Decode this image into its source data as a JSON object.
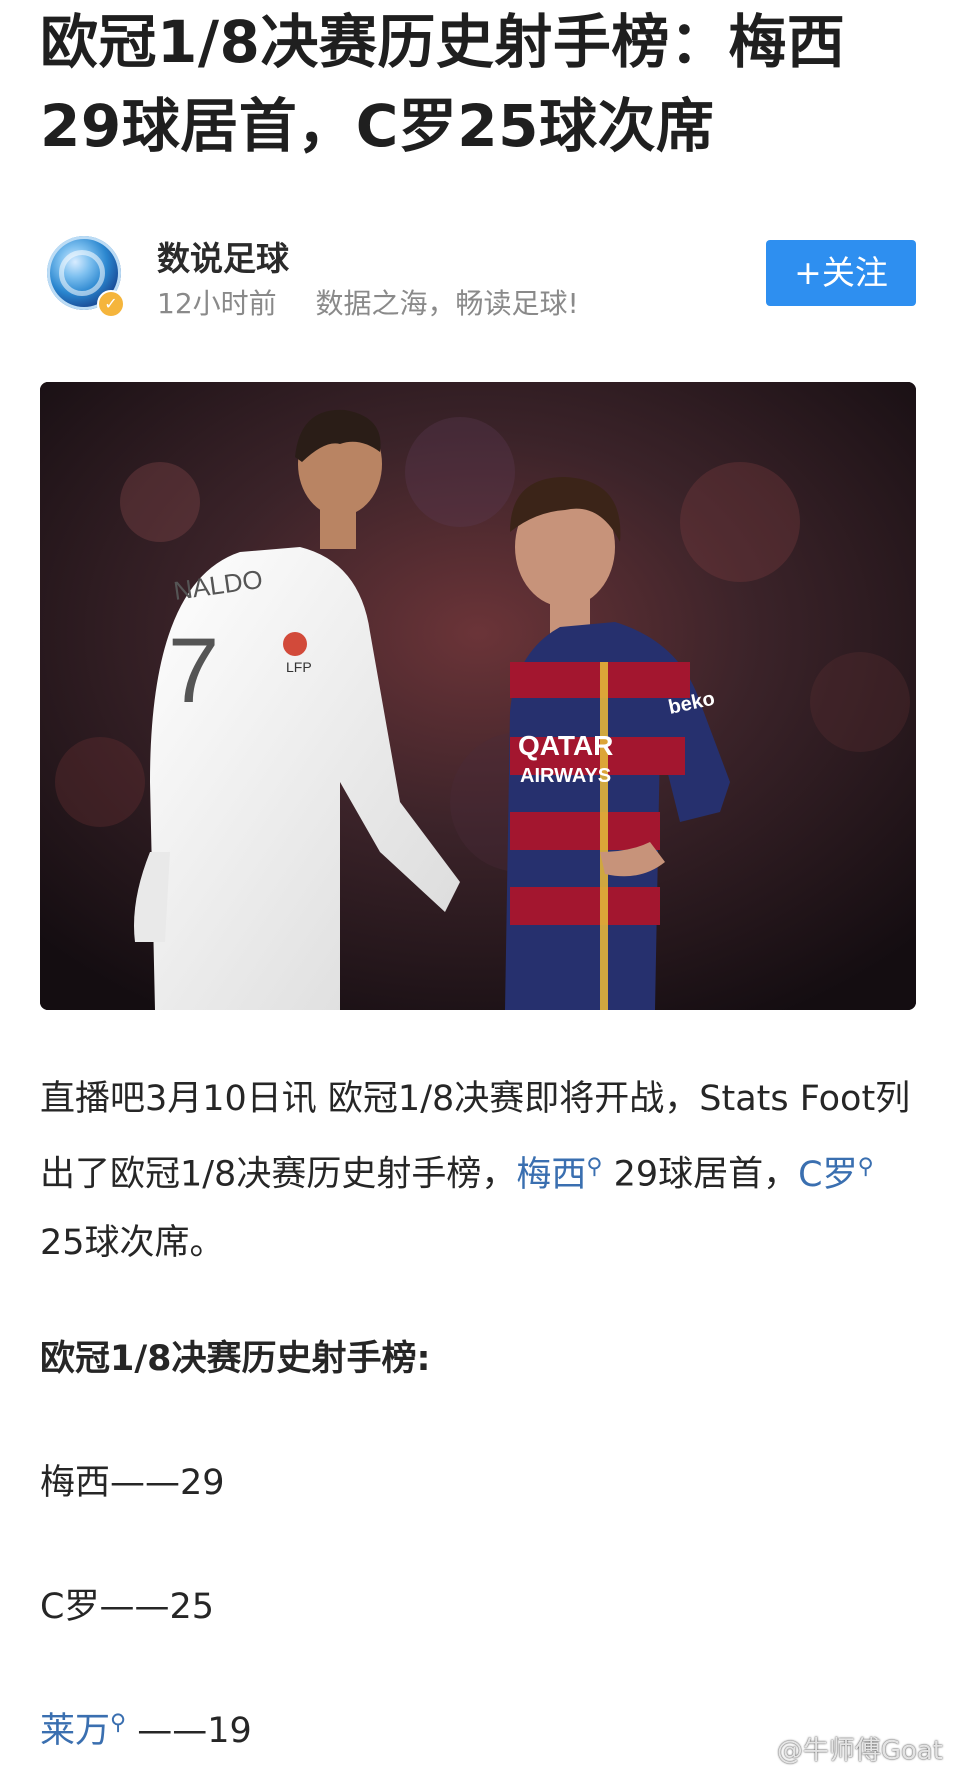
{
  "article": {
    "title_line1": "欧冠1/8决赛历史射手榜：梅西",
    "title_line2": "29球居首，C罗25球次席"
  },
  "author": {
    "name": "数说足球",
    "time": "12小时前",
    "slogan": "数据之海，畅读足球!",
    "follow_label": "+关注",
    "verified_mark": "✓"
  },
  "hero_image": {
    "jersey_sponsor": "QATAR",
    "jersey_sponsor2": "AIRWAYS",
    "jersey_name": "NALDO",
    "jersey_number": "7",
    "sleeve_sponsor": "beko",
    "badge_text": "LFP"
  },
  "body": {
    "p1_a": "直播吧3月10日讯 欧冠1/8决赛即将开战，Stats Foot列出了欧冠1/8决赛历史射手榜，",
    "link_messi": "梅西",
    "p1_b": " 29球居首，",
    "link_cr": "C罗",
    "p1_c": " 25球次席。",
    "search_mark": "⚲"
  },
  "list": {
    "title": "欧冠1/8决赛历史射手榜:",
    "items": [
      {
        "player": "梅西",
        "score": "——29"
      },
      {
        "player": "C罗",
        "score": "——25"
      },
      {
        "player": "莱万",
        "score": "——19"
      }
    ]
  },
  "watermark": "@牛师傅Goat",
  "colors": {
    "accent": "#2e8ff0",
    "link": "#3a6fb0",
    "barca_blue": "#26306e",
    "barca_red": "#a3162f",
    "madrid_white": "#f2f2f2"
  }
}
